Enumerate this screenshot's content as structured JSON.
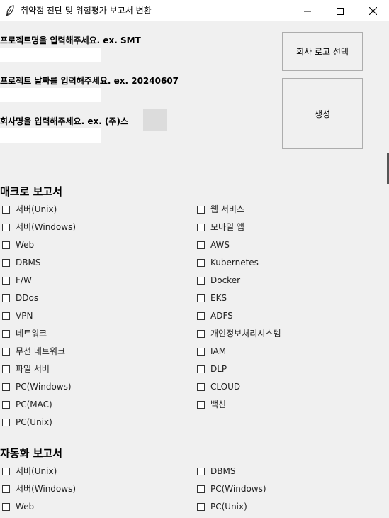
{
  "window": {
    "title": "취약점 진단 및 위험평가 보고서 변환",
    "icon": "feather-icon",
    "buttons": [
      "minimize-icon",
      "maximize-icon",
      "close-icon"
    ]
  },
  "form": {
    "project_name_label": "프로젝트명을 입력해주세요.  ex. SMT",
    "project_name_value": "",
    "project_date_label": "프로젝트 날짜를 입력해주세요.  ex. 20240607",
    "project_date_value": "",
    "company_label": "회사명을 입력해주세요.  ex. (주)스",
    "company_value": ""
  },
  "actions": {
    "logo_button": "회사 로고 선택",
    "generate_button": "생성"
  },
  "macro": {
    "title": "매크로 보고서",
    "left": [
      "서버(Unix)",
      "서버(Windows)",
      "Web",
      "DBMS",
      "F/W",
      "DDos",
      "VPN",
      "네트워크",
      "무선 네트워크",
      "파일 서버",
      "PC(Windows)",
      "PC(MAC)",
      "PC(Unix)"
    ],
    "right": [
      "웹 서비스",
      "모바일 앱",
      "AWS",
      "Kubernetes",
      "Docker",
      "EKS",
      "ADFS",
      "개인정보처리시스템",
      "IAM",
      "DLP",
      "CLOUD",
      "백신"
    ]
  },
  "auto": {
    "title": "자동화 보고서",
    "left": [
      "서버(Unix)",
      "서버(Windows)",
      "Web"
    ],
    "right": [
      "DBMS",
      "PC(Windows)",
      "PC(Unix)"
    ]
  }
}
